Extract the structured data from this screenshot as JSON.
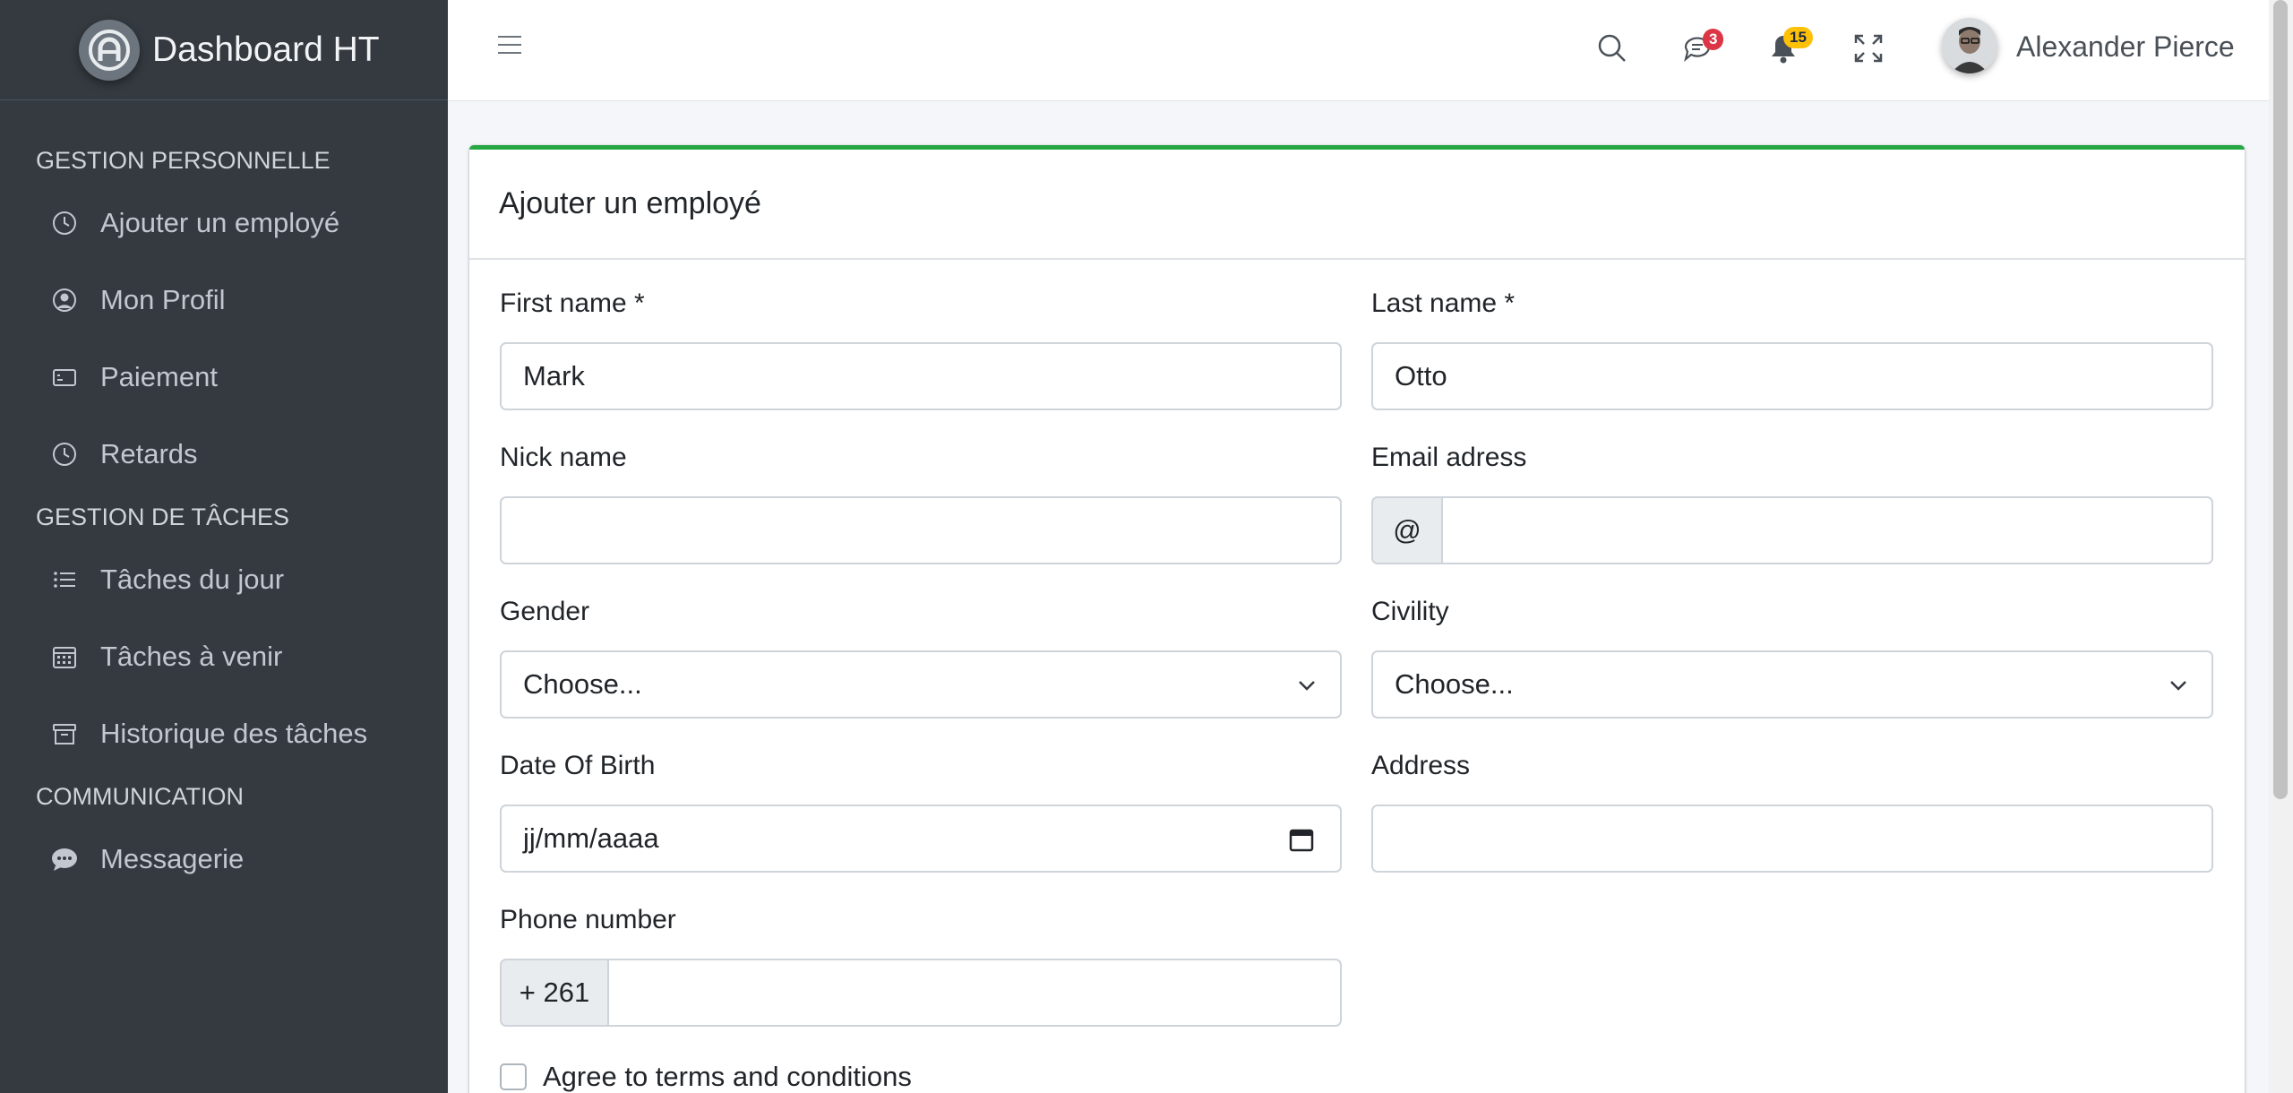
{
  "brand": {
    "name": "Dashboard HT",
    "logo_icon": "user-circle-logo"
  },
  "sidebar": {
    "sections": [
      {
        "header": "GESTION PERSONNELLE"
      },
      {
        "header": "GESTION DE TÂCHES"
      },
      {
        "header": "COMMUNICATION"
      }
    ],
    "items": [
      {
        "label": "Ajouter un employé",
        "icon": "clock-icon"
      },
      {
        "label": "Mon Profil",
        "icon": "user-circle-icon"
      },
      {
        "label": "Paiement",
        "icon": "card-icon"
      },
      {
        "label": "Retards",
        "icon": "clock-icon"
      },
      {
        "label": "Tâches du jour",
        "icon": "list-icon"
      },
      {
        "label": "Tâches à venir",
        "icon": "calendar-icon"
      },
      {
        "label": "Historique des tâches",
        "icon": "archive-icon"
      },
      {
        "label": "Messagerie",
        "icon": "chat-icon"
      }
    ]
  },
  "topbar": {
    "messages_count": "3",
    "notifications_count": "15",
    "user_name": "Alexander Pierce"
  },
  "form": {
    "title": "Ajouter un employé",
    "first_name": {
      "label": "First name *",
      "value": "Mark"
    },
    "last_name": {
      "label": "Last name *",
      "value": "Otto"
    },
    "nick_name": {
      "label": "Nick name",
      "value": ""
    },
    "email": {
      "label": "Email adress",
      "prefix": "@",
      "value": ""
    },
    "gender": {
      "label": "Gender",
      "selected": "Choose..."
    },
    "civility": {
      "label": "Civility",
      "selected": "Choose..."
    },
    "dob": {
      "label": "Date Of Birth",
      "placeholder": "jj/mm/aaaa"
    },
    "address": {
      "label": "Address",
      "value": ""
    },
    "phone": {
      "label": "Phone number",
      "prefix": "+ 261",
      "value": ""
    },
    "agree": {
      "label": "Agree to terms and conditions"
    }
  },
  "colors": {
    "sidebar_bg": "#343a40",
    "card_accent": "#28a745",
    "badge_danger": "#dc3545",
    "badge_warning": "#ffc107"
  }
}
